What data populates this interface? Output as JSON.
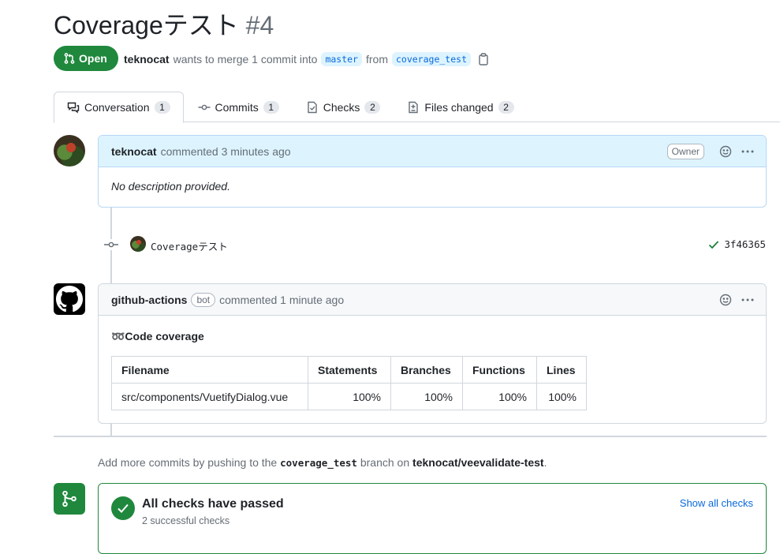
{
  "pr": {
    "title": "Coverageテスト",
    "number": "#4",
    "state": "Open",
    "author": "teknocat",
    "merge_text": "wants to merge 1 commit into",
    "base_branch": "master",
    "from_text": "from",
    "head_branch": "coverage_test"
  },
  "tabs": [
    {
      "label": "Conversation",
      "count": "1",
      "icon": "conversation-icon"
    },
    {
      "label": "Commits",
      "count": "1",
      "icon": "commit-icon"
    },
    {
      "label": "Checks",
      "count": "2",
      "icon": "checks-icon"
    },
    {
      "label": "Files changed",
      "count": "2",
      "icon": "diff-icon"
    }
  ],
  "comment1": {
    "author": "teknocat",
    "action": "commented 3 minutes ago",
    "role": "Owner",
    "body": "No description provided."
  },
  "commit": {
    "message": "Coverageテスト",
    "sha": "3f46365"
  },
  "comment2": {
    "author": "github-actions",
    "badge": "bot",
    "action": "commented 1 minute ago",
    "coverage_title": "➿Code coverage",
    "table": {
      "headers": [
        "Filename",
        "Statements",
        "Branches",
        "Functions",
        "Lines"
      ],
      "rows": [
        [
          "src/components/VuetifyDialog.vue",
          "100%",
          "100%",
          "100%",
          "100%"
        ]
      ]
    }
  },
  "footer": {
    "add_pre": "Add more commits by pushing to the",
    "branch": "coverage_test",
    "add_mid": "branch on",
    "repo": "teknocat/veevalidate-test",
    "add_end": "."
  },
  "checks": {
    "title": "All checks have passed",
    "subtitle": "2 successful checks",
    "link": "Show all checks"
  },
  "colors": {
    "open_green": "#1f883d",
    "link_blue": "#0969da",
    "branch_bg": "#ddf4ff"
  }
}
